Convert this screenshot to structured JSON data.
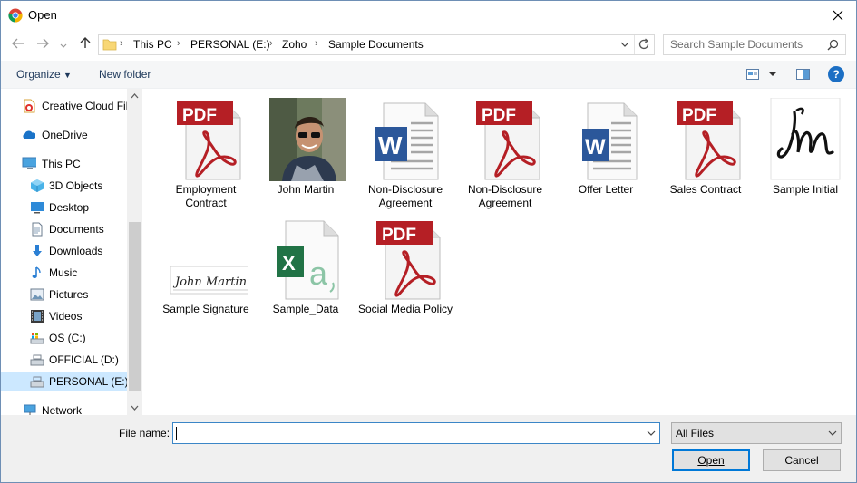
{
  "window": {
    "title": "Open"
  },
  "address": {
    "crumbs": [
      "This PC",
      "PERSONAL (E:)",
      "Zoho",
      "Sample Documents"
    ],
    "search_placeholder": "Search Sample Documents"
  },
  "toolbar": {
    "organize": "Organize",
    "new_folder": "New folder",
    "help": "?"
  },
  "sidebar": {
    "items": [
      {
        "label": "Creative Cloud Fil",
        "icon": "creative-cloud-icon"
      },
      {
        "label": "OneDrive",
        "icon": "onedrive-icon"
      },
      {
        "label": "This PC",
        "icon": "this-pc-icon"
      },
      {
        "label": "3D Objects",
        "icon": "3d-objects-icon"
      },
      {
        "label": "Desktop",
        "icon": "desktop-icon"
      },
      {
        "label": "Documents",
        "icon": "documents-icon"
      },
      {
        "label": "Downloads",
        "icon": "downloads-icon"
      },
      {
        "label": "Music",
        "icon": "music-icon"
      },
      {
        "label": "Pictures",
        "icon": "pictures-icon"
      },
      {
        "label": "Videos",
        "icon": "videos-icon"
      },
      {
        "label": "OS (C:)",
        "icon": "drive-icon"
      },
      {
        "label": "OFFICIAL (D:)",
        "icon": "drive-icon"
      },
      {
        "label": "PERSONAL (E:)",
        "icon": "drive-icon"
      },
      {
        "label": "Network",
        "icon": "network-icon"
      }
    ]
  },
  "files": [
    {
      "name": "Employment Contract",
      "type": "pdf"
    },
    {
      "name": "John Martin",
      "type": "photo"
    },
    {
      "name": "Non-Disclosure Agreement",
      "type": "word"
    },
    {
      "name": "Non-Disclosure Agreement",
      "type": "pdf"
    },
    {
      "name": "Offer Letter",
      "type": "word"
    },
    {
      "name": "Sales Contract",
      "type": "pdf"
    },
    {
      "name": "Sample Initial",
      "type": "signature-image"
    },
    {
      "name": "Sample Signature",
      "type": "signature-image"
    },
    {
      "name": "Sample_Data",
      "type": "excel"
    },
    {
      "name": "Social Media Policy",
      "type": "pdf"
    }
  ],
  "footer": {
    "file_name_label": "File name:",
    "file_name_value": "",
    "filter": "All Files",
    "open": "Open",
    "cancel": "Cancel"
  },
  "colors": {
    "pdf_red": "#b51f25",
    "word_blue": "#2b579a",
    "excel_green": "#217346",
    "selection": "#cce8ff",
    "accent": "#0078d7"
  }
}
